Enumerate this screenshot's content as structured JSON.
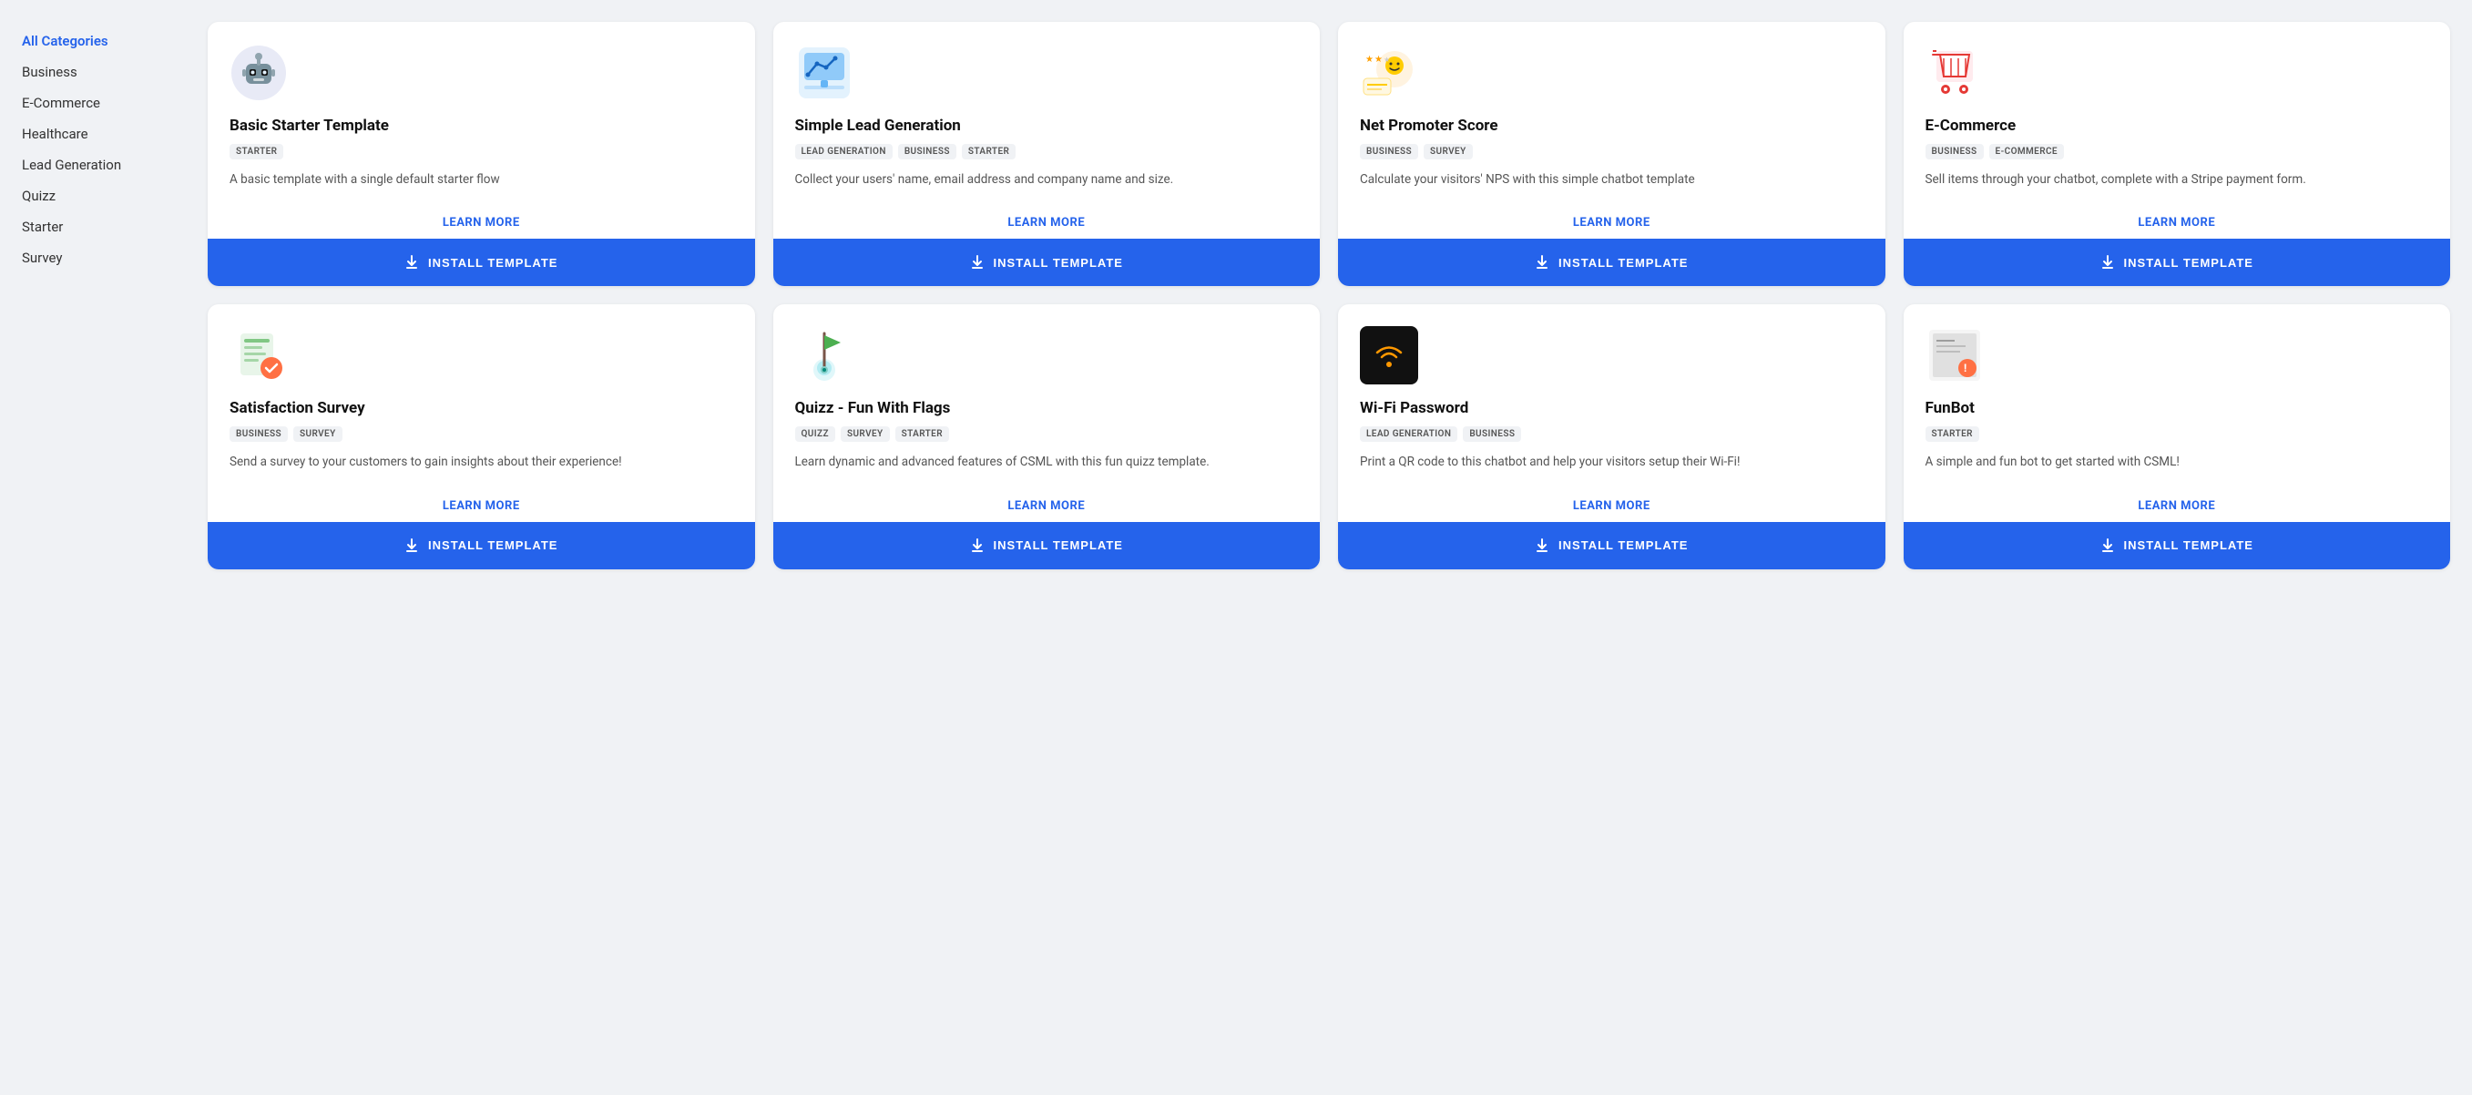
{
  "sidebar": {
    "items": [
      {
        "label": "All Categories",
        "active": true
      },
      {
        "label": "Business",
        "active": false
      },
      {
        "label": "E-Commerce",
        "active": false
      },
      {
        "label": "Healthcare",
        "active": false
      },
      {
        "label": "Lead Generation",
        "active": false
      },
      {
        "label": "Quizz",
        "active": false
      },
      {
        "label": "Starter",
        "active": false
      },
      {
        "label": "Survey",
        "active": false
      }
    ]
  },
  "cards": [
    {
      "id": "basic-starter",
      "title": "Basic Starter Template",
      "tags": [
        "STARTER"
      ],
      "description": "A basic template with a single default starter flow",
      "icon_type": "robot",
      "learn_more": "LEARN MORE",
      "install": "INSTALL TEMPLATE"
    },
    {
      "id": "simple-lead-gen",
      "title": "Simple Lead Generation",
      "tags": [
        "LEAD GENERATION",
        "BUSINESS",
        "STARTER"
      ],
      "description": "Collect your users' name, email address and company name and size.",
      "icon_type": "chart",
      "learn_more": "LEARN MORE",
      "install": "INSTALL TEMPLATE"
    },
    {
      "id": "nps",
      "title": "Net Promoter Score",
      "tags": [
        "BUSINESS",
        "SURVEY"
      ],
      "description": "Calculate your visitors' NPS with this simple chatbot template",
      "icon_type": "nps",
      "learn_more": "LEARN MORE",
      "install": "INSTALL TEMPLATE"
    },
    {
      "id": "ecommerce",
      "title": "E-Commerce",
      "tags": [
        "BUSINESS",
        "E-COMMERCE"
      ],
      "description": "Sell items through your chatbot, complete with a Stripe payment form.",
      "icon_type": "cart",
      "learn_more": "LEARN MORE",
      "install": "INSTALL TEMPLATE"
    },
    {
      "id": "satisfaction-survey",
      "title": "Satisfaction Survey",
      "tags": [
        "BUSINESS",
        "SURVEY"
      ],
      "description": "Send a survey to your customers to gain insights about their experience!",
      "icon_type": "survey",
      "learn_more": "LEARN MORE",
      "install": "INSTALL TEMPLATE"
    },
    {
      "id": "quizz-flags",
      "title": "Quizz - Fun With Flags",
      "tags": [
        "QUIZZ",
        "SURVEY",
        "STARTER"
      ],
      "description": "Learn dynamic and advanced features of CSML with this fun quizz template.",
      "icon_type": "flags",
      "learn_more": "LEARN MORE",
      "install": "INSTALL TEMPLATE"
    },
    {
      "id": "wifi-password",
      "title": "Wi-Fi Password",
      "tags": [
        "LEAD GENERATION",
        "BUSINESS"
      ],
      "description": "Print a QR code to this chatbot and help your visitors setup their Wi-Fi!",
      "icon_type": "wifi",
      "learn_more": "LEARN MORE",
      "install": "INSTALL TEMPLATE"
    },
    {
      "id": "funbot",
      "title": "FunBot",
      "tags": [
        "STARTER"
      ],
      "description": "A simple and fun bot to get started with CSML!",
      "icon_type": "funbot",
      "learn_more": "LEARN MORE",
      "install": "INSTALL TEMPLATE"
    }
  ],
  "colors": {
    "accent": "#2563eb",
    "bg": "#f0f2f5"
  }
}
